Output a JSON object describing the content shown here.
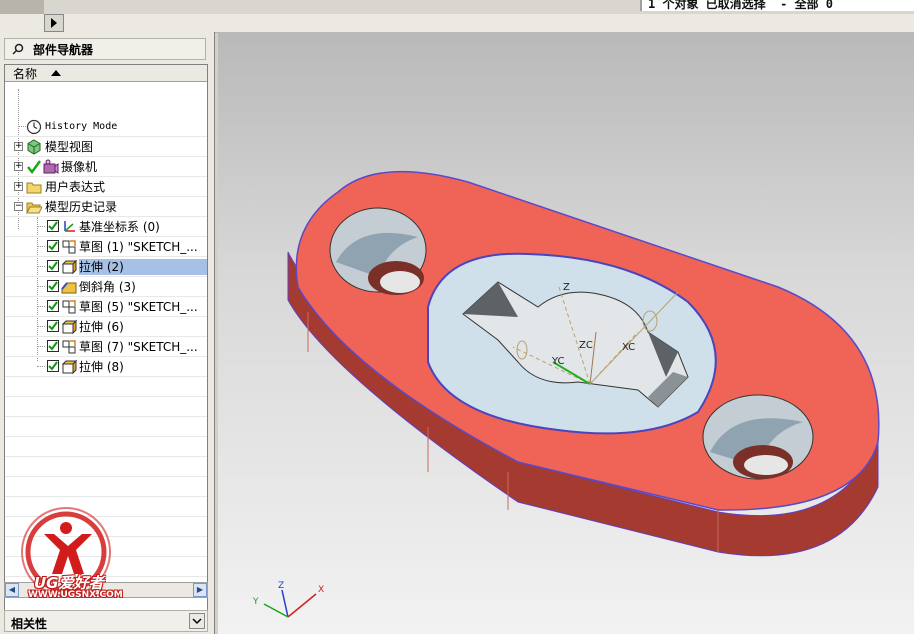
{
  "status_bar": {
    "message": "1 个对象 已取消选择  - 全部 0"
  },
  "navigator": {
    "title": "部件导航器",
    "column_header": "名称",
    "nodes": [
      {
        "label": "History Mode",
        "icon": "clock-icon",
        "checked": false,
        "selected": false
      },
      {
        "label": "模型视图",
        "icon": "model-view-cube-icon",
        "checked": false,
        "selected": false
      },
      {
        "label": "摄像机",
        "icon": "camera-icon",
        "checked": true,
        "selected": false
      },
      {
        "label": "用户表达式",
        "icon": "folder-icon",
        "checked": false,
        "selected": false
      },
      {
        "label": "模型历史记录",
        "icon": "folder-open-icon",
        "checked": false,
        "selected": false
      },
      {
        "label": "基准坐标系 (0)",
        "icon": "datum-csys-icon",
        "checked": true,
        "selected": false
      },
      {
        "label": "草图 (1) \"SKETCH_...",
        "icon": "sketch-icon",
        "checked": true,
        "selected": false
      },
      {
        "label": "拉伸 (2)",
        "icon": "extrude-icon",
        "checked": true,
        "selected": true
      },
      {
        "label": "倒斜角 (3)",
        "icon": "chamfer-icon",
        "checked": true,
        "selected": false
      },
      {
        "label": "草图 (5) \"SKETCH_...",
        "icon": "sketch-icon",
        "checked": true,
        "selected": false
      },
      {
        "label": "拉伸 (6)",
        "icon": "extrude-icon",
        "checked": true,
        "selected": false
      },
      {
        "label": "草图 (7) \"SKETCH_...",
        "icon": "sketch-icon",
        "checked": true,
        "selected": false
      },
      {
        "label": "拉伸 (8)",
        "icon": "extrude-icon",
        "checked": true,
        "selected": false
      }
    ],
    "related_panel": "相关性"
  },
  "viewport": {
    "csys_labels": {
      "x": "XC",
      "y": "YC",
      "z": "ZC"
    },
    "triad_labels": {
      "x": "X",
      "y": "Y",
      "z": "Z"
    },
    "body_color": "#f06458",
    "hole_color": "#cfe0ea"
  },
  "watermark": {
    "brand": "UG爱好者",
    "url": "WWW.UGSNX.COM"
  }
}
